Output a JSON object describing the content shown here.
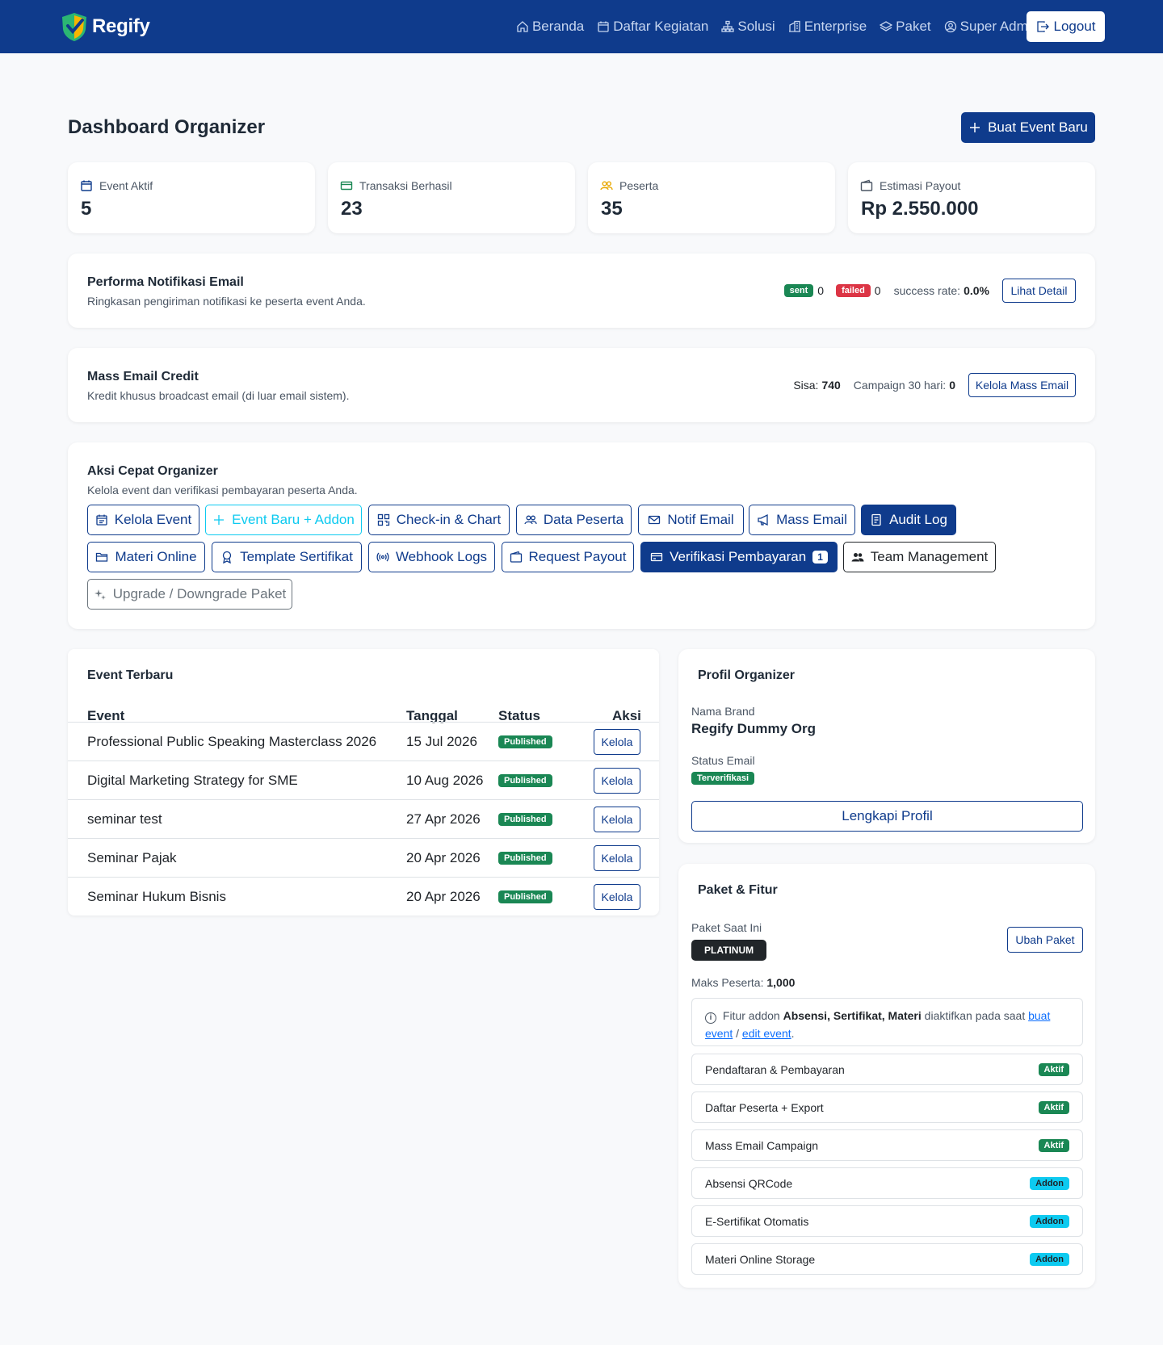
{
  "brand": {
    "name": "Regify"
  },
  "nav": {
    "items": [
      {
        "label": "Beranda",
        "icon": "house-icon"
      },
      {
        "label": "Daftar Kegiatan",
        "icon": "calendar-icon"
      },
      {
        "label": "Solusi",
        "icon": "diagram-icon"
      },
      {
        "label": "Enterprise",
        "icon": "building-icon"
      },
      {
        "label": "Paket",
        "icon": "layers-icon"
      },
      {
        "label": "Super Admin",
        "icon": "user-circle-icon"
      }
    ],
    "logout_label": "Logout"
  },
  "page": {
    "title": "Dashboard Organizer",
    "create_event_label": "Buat Event Baru"
  },
  "stats": [
    {
      "label": "Event Aktif",
      "value": "5",
      "icon": "calendar-icon"
    },
    {
      "label": "Transaksi Berhasil",
      "value": "23",
      "icon": "credit-card-icon"
    },
    {
      "label": "Peserta",
      "value": "35",
      "icon": "people-icon"
    },
    {
      "label": "Estimasi Payout",
      "value": "Rp 2.550.000",
      "icon": "wallet-icon"
    }
  ],
  "email_notif": {
    "title": "Performa Notifikasi Email",
    "subtitle": "Ringkasan pengiriman notifikasi ke peserta event Anda.",
    "sent_badge": "sent",
    "sent_count": "0",
    "failed_badge": "failed",
    "failed_count": "0",
    "success_rate_label": "success rate:",
    "success_rate_value": "0.0%",
    "detail_label": "Lihat Detail"
  },
  "mass_email": {
    "title": "Mass Email Credit",
    "subtitle": "Kredit khusus broadcast email (di luar email sistem).",
    "sisa_label": "Sisa:",
    "sisa_value": "740",
    "campaign_label": "Campaign 30 hari:",
    "campaign_value": "0",
    "manage_label": "Kelola Mass Email"
  },
  "quick_actions": {
    "title": "Aksi Cepat Organizer",
    "subtitle": "Kelola event dan verifikasi pembayaran peserta Anda.",
    "buttons": [
      {
        "label": "Kelola Event",
        "icon": "calendar-grid-icon"
      },
      {
        "label": "Event Baru + Addon",
        "icon": "plus-icon"
      },
      {
        "label": "Check-in & Chart",
        "icon": "qr-code-icon"
      },
      {
        "label": "Data Peserta",
        "icon": "people-icon"
      },
      {
        "label": "Notif Email",
        "icon": "envelope-check-icon"
      },
      {
        "label": "Mass Email",
        "icon": "megaphone-icon"
      },
      {
        "label": "Audit Log",
        "icon": "journal-icon"
      },
      {
        "label": "Materi Online",
        "icon": "folder-icon"
      },
      {
        "label": "Template Sertifikat",
        "icon": "award-icon"
      },
      {
        "label": "Webhook Logs",
        "icon": "broadcast-icon"
      },
      {
        "label": "Request Payout",
        "icon": "wallet-icon"
      },
      {
        "label": "Verifikasi Pembayaran",
        "icon": "credit-card-icon",
        "count": "1"
      },
      {
        "label": "Team Management",
        "icon": "people-fill-icon"
      },
      {
        "label": "Upgrade / Downgrade Paket",
        "icon": "stars-icon"
      }
    ]
  },
  "events": {
    "title": "Event Terbaru",
    "columns": [
      "Event",
      "Tanggal",
      "Status",
      "Aksi"
    ],
    "rows": [
      {
        "name": "Professional Public Speaking Masterclass 2026",
        "date": "15 Jul 2026",
        "status": "Published",
        "action": "Kelola"
      },
      {
        "name": "Digital Marketing Strategy for SME",
        "date": "10 Aug 2026",
        "status": "Published",
        "action": "Kelola"
      },
      {
        "name": "seminar test",
        "date": "27 Apr 2026",
        "status": "Published",
        "action": "Kelola"
      },
      {
        "name": "Seminar Pajak",
        "date": "20 Apr 2026",
        "status": "Published",
        "action": "Kelola"
      },
      {
        "name": "Seminar Hukum Bisnis",
        "date": "20 Apr 2026",
        "status": "Published",
        "action": "Kelola"
      }
    ]
  },
  "profile": {
    "title": "Profil Organizer",
    "brand_label": "Nama Brand",
    "brand_value": "Regify Dummy Org",
    "email_status_label": "Status Email",
    "email_status_value": "Terverifikasi",
    "complete_label": "Lengkapi Profil"
  },
  "package": {
    "title": "Paket & Fitur",
    "current_label": "Paket Saat Ini",
    "current_value": "PLATINUM",
    "change_label": "Ubah Paket",
    "max_label": "Maks Peserta:",
    "max_value": "1,000",
    "info": {
      "prefix": "Fitur addon",
      "features": "Absensi, Sertifikat, Materi",
      "middle": "diaktifkan pada saat",
      "link1": "buat event",
      "sep": "/",
      "link2": "edit event",
      "end": "."
    },
    "features": [
      {
        "name": "Pendaftaran & Pembayaran",
        "badge": "Aktif"
      },
      {
        "name": "Daftar Peserta + Export",
        "badge": "Aktif"
      },
      {
        "name": "Mass Email Campaign",
        "badge": "Aktif"
      },
      {
        "name": "Absensi QRCode",
        "badge": "Addon"
      },
      {
        "name": "E-Sertifikat Otomatis",
        "badge": "Addon"
      },
      {
        "name": "Materi Online Storage",
        "badge": "Addon"
      }
    ]
  },
  "colors": {
    "primary": "#0f3b8c",
    "success": "#1a8754",
    "danger": "#dc3545",
    "info": "#0dcaf0",
    "background": "#f8f9fb"
  }
}
